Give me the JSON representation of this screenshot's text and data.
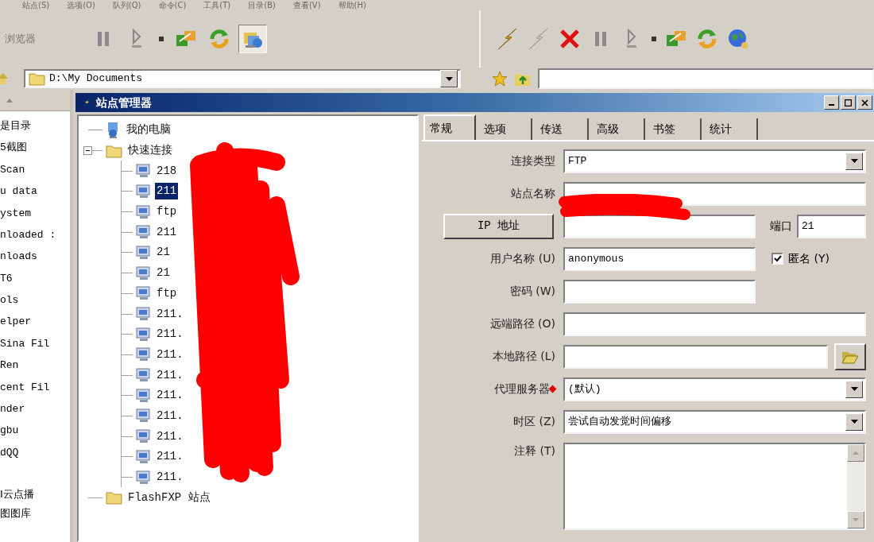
{
  "menu_bar": [
    "站点(S)",
    "选项(O)",
    "队列(Q)",
    "命令(C)",
    "工具(T)",
    "目录(B)",
    "查看(V)",
    "帮助(H)"
  ],
  "left_toolbar": {
    "label": "浏览器",
    "buttons": [
      {
        "kind": "pause",
        "pressed": false
      },
      {
        "kind": "transfer",
        "pressed": false
      },
      {
        "kind": "dropdown",
        "pressed": false
      },
      {
        "kind": "queue",
        "pressed": false
      },
      {
        "kind": "refresh",
        "pressed": false
      },
      {
        "kind": "site",
        "pressed": true
      }
    ]
  },
  "right_toolbar": {
    "buttons": [
      {
        "kind": "connect",
        "pressed": false
      },
      {
        "kind": "disconnect",
        "pressed": false
      },
      {
        "kind": "abort",
        "pressed": false
      },
      {
        "kind": "pause",
        "pressed": false
      },
      {
        "kind": "transfer",
        "pressed": false
      },
      {
        "kind": "dropdown",
        "pressed": false
      },
      {
        "kind": "queue",
        "pressed": false
      },
      {
        "kind": "refresh",
        "pressed": false
      },
      {
        "kind": "globe",
        "pressed": false
      }
    ]
  },
  "left_path": {
    "value": "D:\\My Documents"
  },
  "file_list": [
    "是目录",
    "5截图",
    "Scan",
    "u data",
    "ystem",
    "nloaded :",
    "nloads",
    "T6",
    "ols",
    "elper",
    "Sina Fil",
    "Ren",
    "cent Fil",
    "nder",
    "gbu",
    "dQQ"
  ],
  "file_list_bottom": [
    "I云点播",
    "图图库"
  ],
  "site_manager": {
    "title": "站点管理器",
    "tree": [
      {
        "label": "我的电脑",
        "kind": "computer",
        "selected": false
      },
      {
        "label": "快速连接",
        "kind": "folder",
        "selected": false,
        "expanded": true,
        "children": [
          {
            "label": "218",
            "selected": false
          },
          {
            "label": "211",
            "selected": true
          },
          {
            "label": "ftp",
            "selected": false
          },
          {
            "label": "211",
            "selected": false
          },
          {
            "label": "21",
            "selected": false
          },
          {
            "label": "21",
            "selected": false
          },
          {
            "label": "ftp",
            "selected": false
          },
          {
            "label": "211.",
            "selected": false
          },
          {
            "label": "211.",
            "selected": false
          },
          {
            "label": "211.",
            "selected": false
          },
          {
            "label": "211.",
            "selected": false
          },
          {
            "label": "211.",
            "selected": false
          },
          {
            "label": "211.",
            "selected": false
          },
          {
            "label": "211.",
            "selected": false
          },
          {
            "label": "211.",
            "selected": false
          },
          {
            "label": "211.",
            "selected": false
          }
        ]
      },
      {
        "label": "FlashFXP 站点",
        "kind": "folder",
        "selected": false
      }
    ],
    "tabs": [
      {
        "label": "常规",
        "selected": true
      },
      {
        "label": "选项",
        "selected": false
      },
      {
        "label": "传送",
        "selected": false
      },
      {
        "label": "高级",
        "selected": false
      },
      {
        "label": "书签",
        "selected": false
      },
      {
        "label": "统计",
        "selected": false
      }
    ],
    "fields": [
      {
        "kind": "select",
        "label": "连接类型",
        "value": "FTP"
      },
      {
        "kind": "text",
        "label": "站点名称"
      },
      {
        "kind": "address",
        "button": "IP 地址",
        "port_label": "端口",
        "port": "21"
      },
      {
        "kind": "short-text",
        "label": "用户名称 (U)",
        "value": "anonymous",
        "checkbox": {
          "label": "匿名 (Y)",
          "checked": true
        }
      },
      {
        "kind": "short-text",
        "label": "密码 (W)"
      },
      {
        "kind": "text",
        "label": "远端路径 (O)"
      },
      {
        "kind": "path",
        "label": "本地路径 (L)"
      },
      {
        "kind": "select",
        "label": "代理服务器",
        "value": "(默认)",
        "marked": true
      },
      {
        "kind": "select",
        "label": "时区 (Z)",
        "value": "尝试自动发觉时间偏移"
      },
      {
        "kind": "textarea",
        "label": "注释 (T)"
      }
    ]
  }
}
